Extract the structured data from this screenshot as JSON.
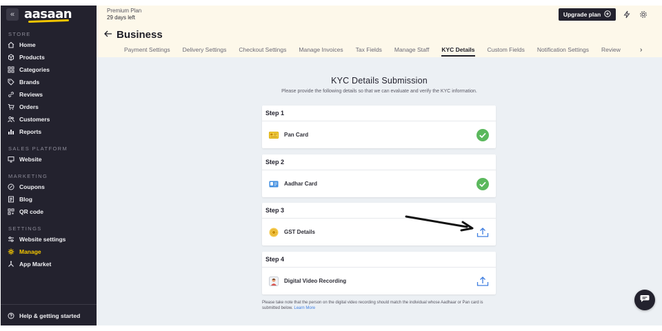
{
  "app": {
    "logo_text": "aasaan",
    "colors": {
      "sidebar_bg": "#23222e",
      "accent": "#f4c600",
      "header_bg": "#fdf8ea",
      "main_bg": "#ecf0f4",
      "success": "#5bb85d",
      "upload": "#3d7de0"
    }
  },
  "sidebar": {
    "collapse_icon": "double-chevron-left-icon",
    "sections": [
      {
        "title": "STORE",
        "items": [
          {
            "label": "Home",
            "icon": "home-icon"
          },
          {
            "label": "Products",
            "icon": "box-icon"
          },
          {
            "label": "Categories",
            "icon": "grid-icon"
          },
          {
            "label": "Brands",
            "icon": "tag-icon"
          },
          {
            "label": "Reviews",
            "icon": "link-icon"
          },
          {
            "label": "Orders",
            "icon": "cart-icon"
          },
          {
            "label": "Customers",
            "icon": "users-icon"
          },
          {
            "label": "Reports",
            "icon": "bar-chart-icon"
          }
        ]
      },
      {
        "title": "SALES PLATFORM",
        "items": [
          {
            "label": "Website",
            "icon": "monitor-icon"
          }
        ]
      },
      {
        "title": "MARKETING",
        "items": [
          {
            "label": "Coupons",
            "icon": "percent-icon"
          },
          {
            "label": "Blog",
            "icon": "document-icon"
          },
          {
            "label": "QR code",
            "icon": "qr-icon"
          }
        ]
      },
      {
        "title": "SETTINGS",
        "items": [
          {
            "label": "Website settings",
            "icon": "sliders-icon"
          },
          {
            "label": "Manage",
            "icon": "gear-icon",
            "active": true
          },
          {
            "label": "App Market",
            "icon": "apps-icon"
          }
        ]
      }
    ],
    "help_label": "Help & getting started"
  },
  "header": {
    "plan_name": "Premium Plan",
    "plan_days": "29 days left",
    "upgrade_label": "Upgrade plan",
    "page_title": "Business",
    "tabs": [
      "Payment Settings",
      "Delivery Settings",
      "Checkout Settings",
      "Manage Invoices",
      "Tax Fields",
      "Manage Staff",
      "KYC Details",
      "Custom Fields",
      "Notification Settings",
      "Review"
    ],
    "active_tab": "KYC Details"
  },
  "kyc": {
    "title": "KYC Details Submission",
    "subtitle": "Please provide the following details so that we can evaluate and verify the KYC information.",
    "steps": [
      {
        "step": "Step 1",
        "label": "Pan Card",
        "status": "verified",
        "icon": "card-icon"
      },
      {
        "step": "Step 2",
        "label": "Aadhar Card",
        "status": "verified",
        "icon": "id-card-icon"
      },
      {
        "step": "Step 3",
        "label": "GST Details",
        "status": "upload",
        "icon": "gst-seal-icon"
      },
      {
        "step": "Step 4",
        "label": "Digital Video Recording",
        "status": "upload",
        "icon": "video-person-icon"
      }
    ],
    "note_text": "Please take note that the person on the digital video recording should match the individual whose Aadhaar or Pan card is submitted below.",
    "note_link": "Learn More"
  }
}
